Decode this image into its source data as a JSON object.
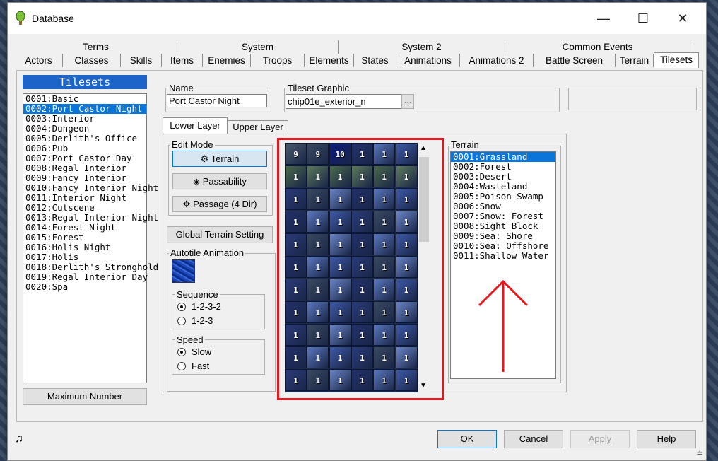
{
  "window": {
    "title": "Database"
  },
  "tabs_top": [
    "Terms",
    "System",
    "System 2",
    "Common Events"
  ],
  "tabs_bottom": [
    "Actors",
    "Classes",
    "Skills",
    "Items",
    "Enemies",
    "Troops",
    "Elements",
    "States",
    "Animations",
    "Animations 2",
    "Battle Screen",
    "Terrain",
    "Tilesets"
  ],
  "active_tab": "Tilesets",
  "tilesets": {
    "header": "Tilesets",
    "items": [
      "0001:Basic",
      "0002:Port Castor Night",
      "0003:Interior",
      "0004:Dungeon",
      "0005:Derlith's Office",
      "0006:Pub",
      "0007:Port Castor Day",
      "0008:Regal Interior",
      "0009:Fancy Interior",
      "0010:Fancy Interior Night",
      "0011:Interior Night",
      "0012:Cutscene",
      "0013:Regal Interior Night",
      "0014:Forest Night",
      "0015:Forest",
      "0016:Holis Night",
      "0017:Holis",
      "0018:Derlith's Stronghold",
      "0019:Regal Interior Day",
      "0020:Spa"
    ],
    "selected_index": 1,
    "max_button": "Maximum Number"
  },
  "name": {
    "label": "Name",
    "value": "Port Castor Night"
  },
  "graphic": {
    "label": "Tileset Graphic",
    "value": "chip01e_exterior_n",
    "browse": "..."
  },
  "layers": {
    "lower": "Lower Layer",
    "upper": "Upper Layer"
  },
  "edit_mode": {
    "label": "Edit Mode",
    "terrain": "Terrain",
    "passability": "Passability",
    "passage": "Passage (4 Dir)"
  },
  "global_terrain": "Global Terrain Setting",
  "autotile": {
    "label": "Autotile Animation",
    "sequence_label": "Sequence",
    "seq1": "1-2-3-2",
    "seq2": "1-2-3",
    "speed_label": "Speed",
    "slow": "Slow",
    "fast": "Fast"
  },
  "terrain": {
    "label": "Terrain",
    "items": [
      "0001:Grassland",
      "0002:Forest",
      "0003:Desert",
      "0004:Wasteland",
      "0005:Poison Swamp",
      "0006:Snow",
      "0007:Snow: Forest",
      "0008:Sight Block",
      "0009:Sea: Shore",
      "0010:Sea: Offshore",
      "0011:Shallow Water"
    ],
    "selected_index": 0
  },
  "tile_rows": [
    [
      "9",
      "9",
      "10",
      "1",
      "1",
      "1"
    ],
    [
      "1",
      "1",
      "1",
      "1",
      "1",
      "1"
    ],
    [
      "1",
      "1",
      "1",
      "1",
      "1",
      "1"
    ],
    [
      "1",
      "1",
      "1",
      "1",
      "1",
      "1"
    ],
    [
      "1",
      "1",
      "1",
      "1",
      "1",
      "1"
    ],
    [
      "1",
      "1",
      "1",
      "1",
      "1",
      "1"
    ],
    [
      "1",
      "1",
      "1",
      "1",
      "1",
      "1"
    ],
    [
      "1",
      "1",
      "1",
      "1",
      "1",
      "1"
    ],
    [
      "1",
      "1",
      "1",
      "1",
      "1",
      "1"
    ],
    [
      "1",
      "1",
      "1",
      "1",
      "1",
      "1"
    ],
    [
      "1",
      "1",
      "1",
      "1",
      "1",
      "1"
    ]
  ],
  "footer": {
    "ok": "OK",
    "cancel": "Cancel",
    "apply": "Apply",
    "help": "Help"
  },
  "colors": {
    "highlight": "#e8141c",
    "selection": "#0a74d8",
    "tileset_header": "#1c64c8"
  }
}
